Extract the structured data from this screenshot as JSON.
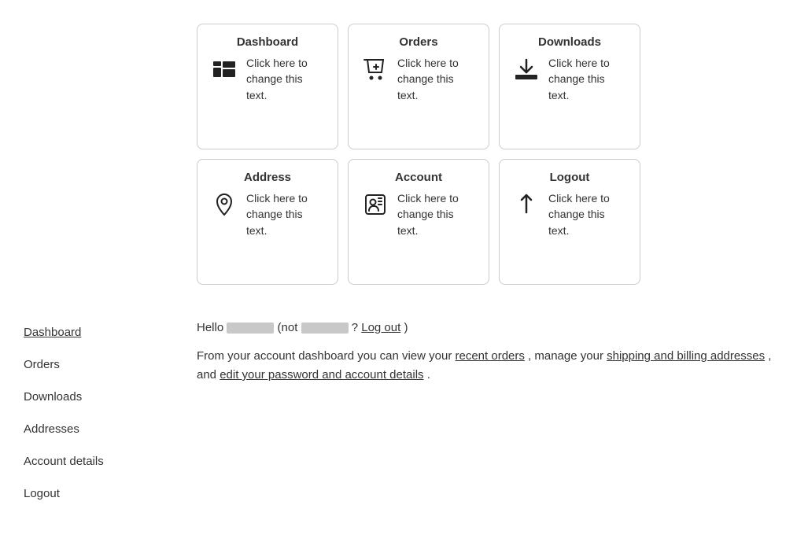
{
  "cards": [
    {
      "id": "dashboard",
      "title": "Dashboard",
      "text": "Click here to change this text.",
      "icon": "dashboard"
    },
    {
      "id": "orders",
      "title": "Orders",
      "text": "Click here to change this text.",
      "icon": "orders"
    },
    {
      "id": "downloads",
      "title": "Downloads",
      "text": "Click here to change this text.",
      "icon": "downloads"
    },
    {
      "id": "address",
      "title": "Address",
      "text": "Click here to change this text.",
      "icon": "address"
    },
    {
      "id": "account",
      "title": "Account",
      "text": "Click here to change this text.",
      "icon": "account"
    },
    {
      "id": "logout",
      "title": "Logout",
      "text": "Click here to change this text.",
      "icon": "logout"
    }
  ],
  "sidebar": {
    "items": [
      {
        "label": "Dashboard",
        "active": true
      },
      {
        "label": "Orders",
        "active": false
      },
      {
        "label": "Downloads",
        "active": false
      },
      {
        "label": "Addresses",
        "active": false
      },
      {
        "label": "Account details",
        "active": false
      },
      {
        "label": "Logout",
        "active": false
      }
    ]
  },
  "hello": {
    "prefix": "Hello",
    "middle": "(not",
    "suffix": "? ",
    "logout_label": "Log out",
    "closing": ")"
  },
  "description": {
    "prefix": "From your account dashboard you can view your ",
    "link1": "recent orders",
    "middle1": ", manage your ",
    "link2": "shipping and billing addresses",
    "middle2": ", and ",
    "link3": "edit your password and account details",
    "suffix": "."
  }
}
